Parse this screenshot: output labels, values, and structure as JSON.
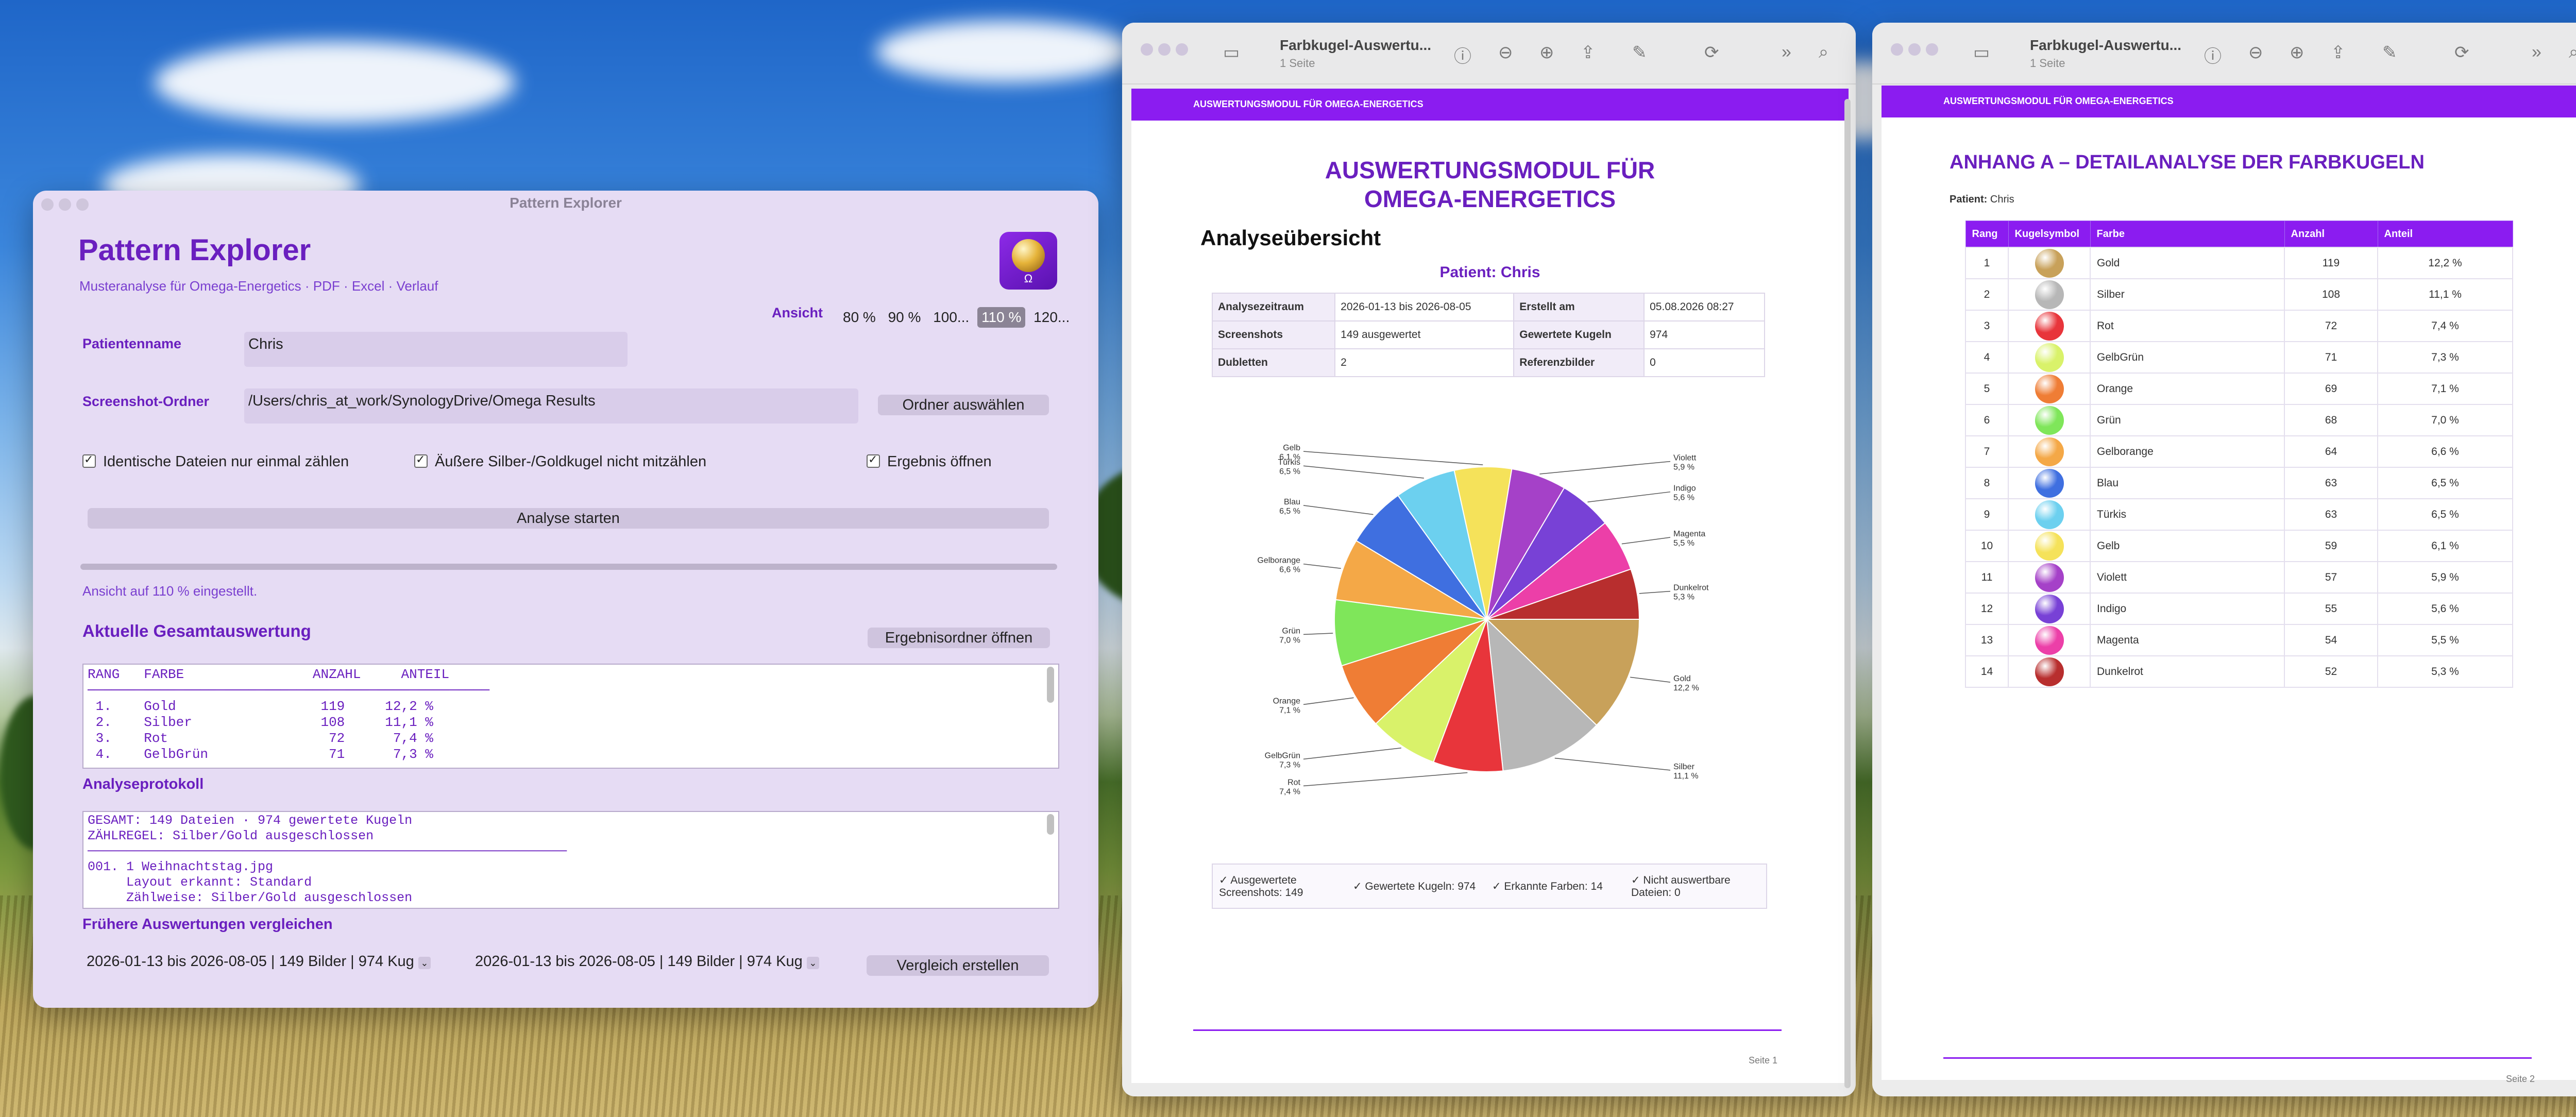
{
  "colors": {
    "accent": "#8b1cf0",
    "purple_text": "#6a1fbf"
  },
  "pe": {
    "window_title": "Pattern Explorer",
    "title": "Pattern Explorer",
    "subtitle": "Musteranalyse für Omega-Energetics · PDF · Excel · Verlauf",
    "logo_glyph": "Ω",
    "view_label": "Ansicht",
    "zoom_options": [
      "80 %",
      "90 %",
      "100...",
      "110 %",
      "120..."
    ],
    "zoom_selected": "110 %",
    "patient_label": "Patientenname",
    "patient_value": "Chris",
    "folder_label": "Screenshot-Ordner",
    "folder_value": "/Users/chris_at_work/SynologyDrive/Omega Results",
    "folder_button": "Ordner auswählen",
    "check1": "Identische Dateien nur einmal zählen",
    "check2": "Äußere Silber-/Goldkugel nicht mitzählen",
    "check3": "Ergebnis öffnen",
    "start_button": "Analyse starten",
    "status": "Ansicht auf 110 % eingestellt.",
    "section1": "Aktuelle Gesamtauswertung",
    "open_results_button": "Ergebnisordner öffnen",
    "results_text": "RANG   FARBE                ANZAHL     ANTEIL\n──────────────────────────────────────────────────\n 1.    Gold                  119     12,2 %\n 2.    Silber                108     11,1 %\n 3.    Rot                    72      7,4 %\n 4.    GelbGrün               71      7,3 %",
    "section2": "Analyseprotokoll",
    "protocol_text": "GESAMT: 149 Dateien · 974 gewertete Kugeln\nZÄHLREGEL: Silber/Gold ausgeschlossen\n──────────────────────────────────────────────────────────────\n001. 1 Weihnachtstag.jpg\n     Layout erkannt: Standard\n     Zählweise: Silber/Gold ausgeschlossen",
    "section3": "Frühere Auswertungen vergleichen",
    "compare_a": "2026-01-13 bis 2026-08-05 | 149 Bilder | 974 Kug",
    "compare_b": "2026-01-13 bis 2026-08-05 | 149 Bilder | 974 Kug",
    "compare_button": "Vergleich erstellen"
  },
  "pdf1": {
    "window_title": "Farbkugel-Auswertu...",
    "window_sub": "1 Seite",
    "band_text": "AUSWERTUNGSMODUL FÜR OMEGA-ENERGETICS",
    "title_line1": "AUSWERTUNGSMODUL FÜR",
    "title_line2": "OMEGA-ENERGETICS",
    "section": "Analyseübersicht",
    "patient": "Patient: Chris",
    "meta": [
      [
        "Analysezeitraum",
        "2026-01-13 bis 2026-08-05",
        "Erstellt am",
        "05.08.2026 08:27"
      ],
      [
        "Screenshots",
        "149 ausgewertet",
        "Gewertete Kugeln",
        "974"
      ],
      [
        "Dubletten",
        "2",
        "Referenzbilder",
        "0"
      ]
    ],
    "summary": [
      "✓ Ausgewertete Screenshots: 149",
      "✓ Gewertete Kugeln: 974",
      "✓ Erkannte Farben: 14",
      "✓ Nicht auswertbare Dateien: 0"
    ],
    "page_num": "Seite 1"
  },
  "pdf2": {
    "window_title": "Farbkugel-Auswertu...",
    "window_sub": "1 Seite",
    "band_text": "AUSWERTUNGSMODUL FÜR OMEGA-ENERGETICS",
    "title": "ANHANG A – DETAILANALYSE DER FARBKUGELN",
    "patient_label": "Patient:",
    "patient_value": "Chris",
    "headers": [
      "Rang",
      "Kugelsymbol",
      "Farbe",
      "Anzahl",
      "Anteil"
    ],
    "page_num": "Seite 2"
  },
  "chart_data": {
    "type": "pie",
    "title": "",
    "categories": [
      "Gold",
      "Silber",
      "Rot",
      "GelbGrün",
      "Orange",
      "Grün",
      "Gelborange",
      "Blau",
      "Türkis",
      "Gelb",
      "Violett",
      "Indigo",
      "Magenta",
      "Dunkelrot"
    ],
    "values": [
      119,
      108,
      72,
      71,
      69,
      68,
      64,
      63,
      63,
      59,
      57,
      55,
      54,
      52
    ],
    "percent_labels": [
      "12,2 %",
      "11,1 %",
      "7,4 %",
      "7,3 %",
      "7,1 %",
      "7,0 %",
      "6,6 %",
      "6,5 %",
      "6,5 %",
      "6,1 %",
      "5,9 %",
      "5,6 %",
      "5,5 %",
      "5,3 %"
    ],
    "colors": [
      "#c8a15a",
      "#b7b7b7",
      "#e8353b",
      "#d9f26a",
      "#ef7d35",
      "#7fe65a",
      "#f4a847",
      "#3f6fe0",
      "#6cd0ef",
      "#f5e25a",
      "#a541c8",
      "#7841d6",
      "#ec3fa8",
      "#b82e2e"
    ],
    "legend": "none"
  }
}
